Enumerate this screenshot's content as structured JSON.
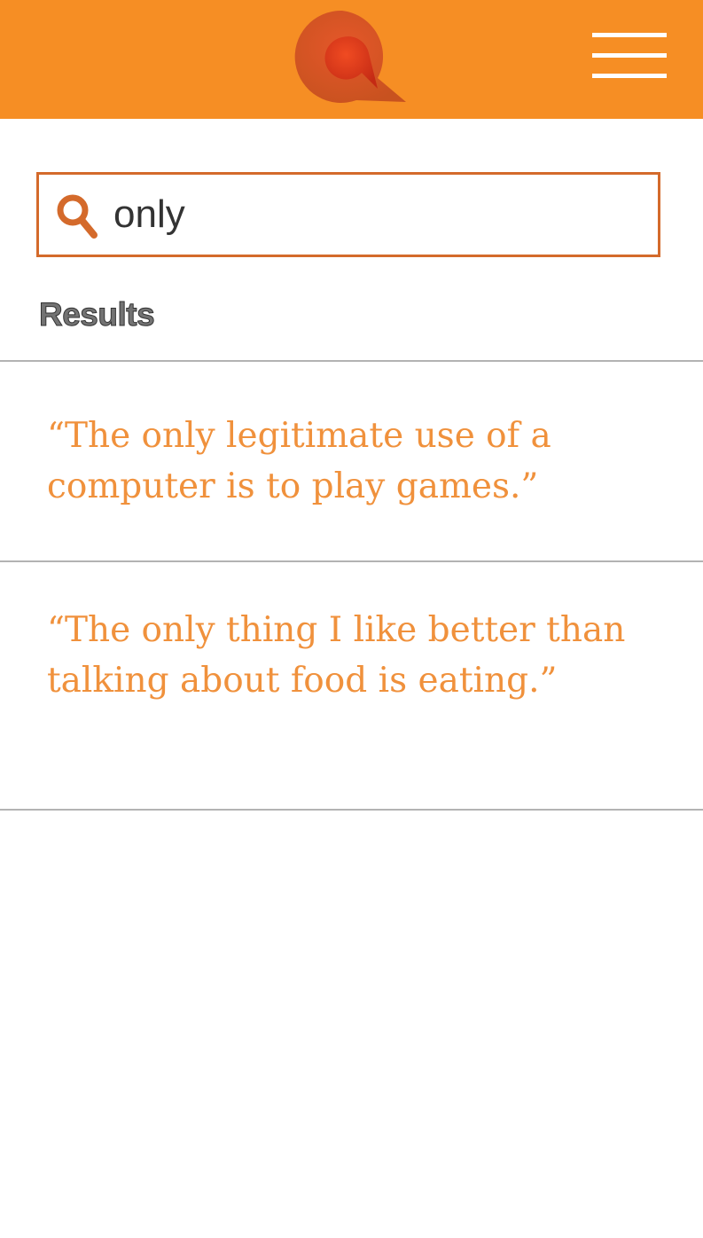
{
  "header": {
    "background_color": "#f68e24",
    "logo_icon": "quote-bubble-logo-icon",
    "menu_icon": "hamburger-menu-icon"
  },
  "search": {
    "value": "only",
    "placeholder": "",
    "border_color": "#d46a2b",
    "icon": "search-icon"
  },
  "results": {
    "heading": "Results",
    "accent_color": "#f0913c",
    "items": [
      {
        "text": "“The only legitimate use of a computer is to play games.”"
      },
      {
        "text": "“The only thing I like better than talking about food is eating.”"
      }
    ]
  }
}
